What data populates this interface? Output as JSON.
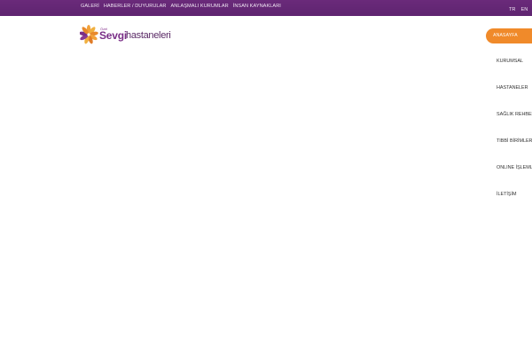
{
  "topnav": {
    "items": [
      "GALERİ",
      "HABERLER / DUYURULAR",
      "ANLAŞMALI KURUMLAR",
      "İNSAN KAYNAKLARI"
    ]
  },
  "lang": {
    "tr": "TR",
    "en": "EN"
  },
  "logo": {
    "ozel": "Özel",
    "sevgi": "Sevgi",
    "hastaneleri": "hastaneleri"
  },
  "home_button": {
    "label": "ANASAYFA"
  },
  "menu": {
    "items": [
      "KURUMSAL",
      "HASTANELER",
      "SAĞLIK REHBERİ",
      "TIBBİ BİRİMLER",
      "ONLINE İŞLEMLER",
      "İLETİŞİM"
    ]
  },
  "colors": {
    "topbar": "#6a2a7a",
    "accent": "#f08a2a",
    "logo_purple": "#7a2f87"
  }
}
